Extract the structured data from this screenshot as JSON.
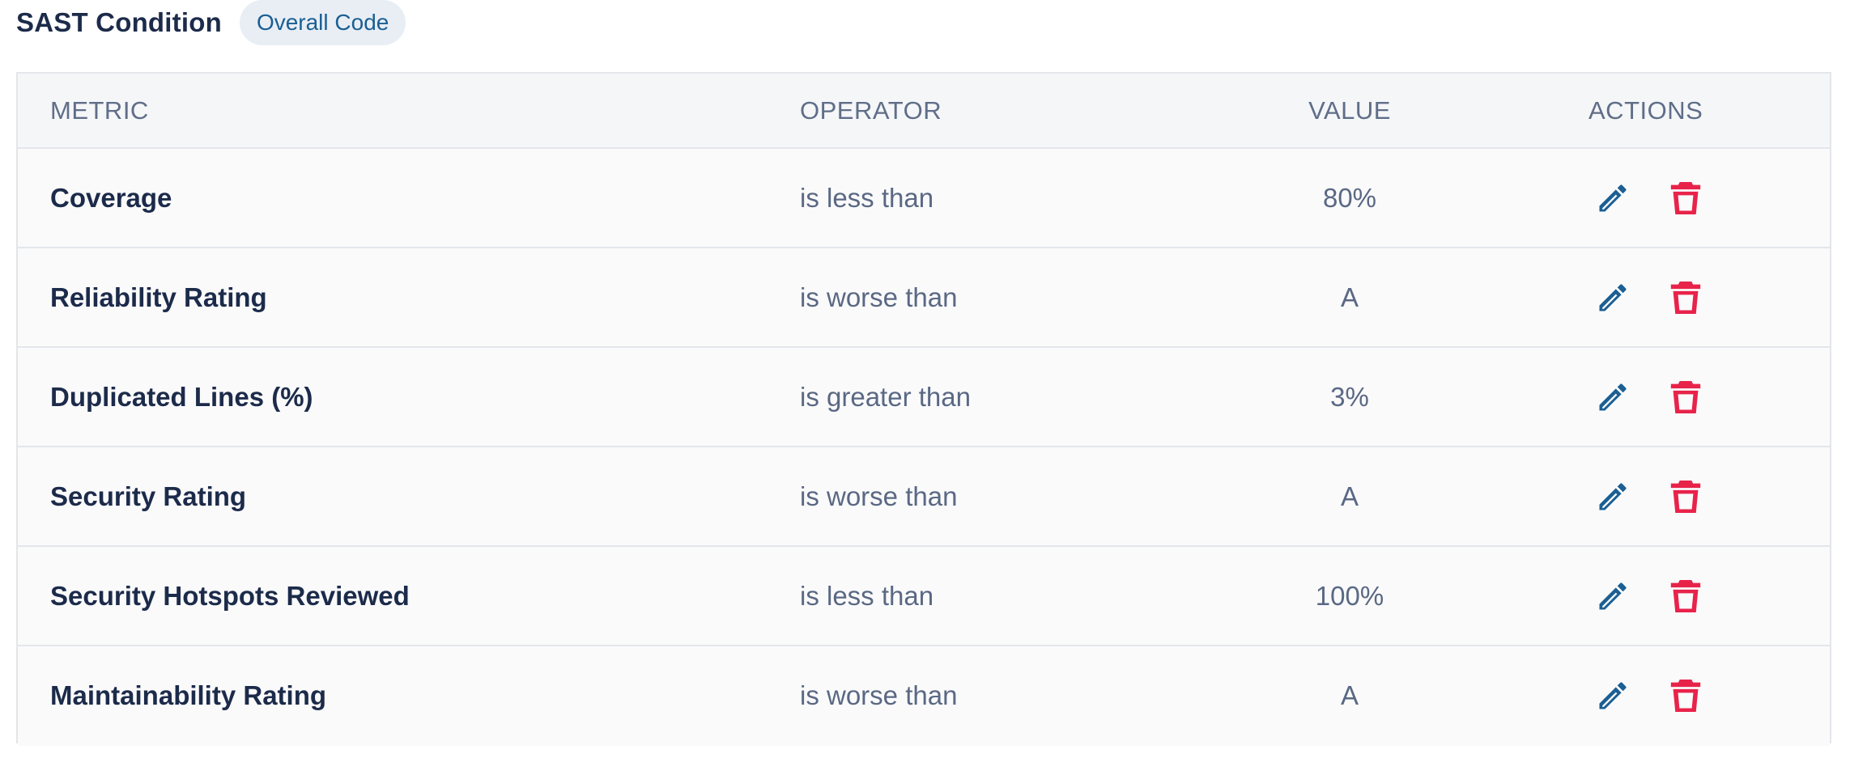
{
  "header": {
    "title": "SAST Condition",
    "badge": "Overall Code"
  },
  "table": {
    "columns": {
      "metric": "METRIC",
      "operator": "OPERATOR",
      "value": "VALUE",
      "actions": "ACTIONS"
    },
    "rows": [
      {
        "metric": "Coverage",
        "operator": "is less than",
        "value": "80%"
      },
      {
        "metric": "Reliability Rating",
        "operator": "is worse than",
        "value": "A"
      },
      {
        "metric": "Duplicated Lines (%)",
        "operator": "is greater than",
        "value": "3%"
      },
      {
        "metric": "Security Rating",
        "operator": "is worse than",
        "value": "A"
      },
      {
        "metric": "Security Hotspots Reviewed",
        "operator": "is less than",
        "value": "100%"
      },
      {
        "metric": "Maintainability Rating",
        "operator": "is worse than",
        "value": "A"
      }
    ]
  },
  "icons": {
    "edit": "pencil-icon",
    "delete": "trash-icon"
  },
  "colors": {
    "title": "#1c2b4a",
    "badge_bg": "#e8eef4",
    "badge_text": "#1b5f93",
    "header_text": "#5f6e88",
    "edit_icon": "#1b5f93",
    "delete_icon": "#e8234a",
    "border": "#e3e6ea"
  }
}
